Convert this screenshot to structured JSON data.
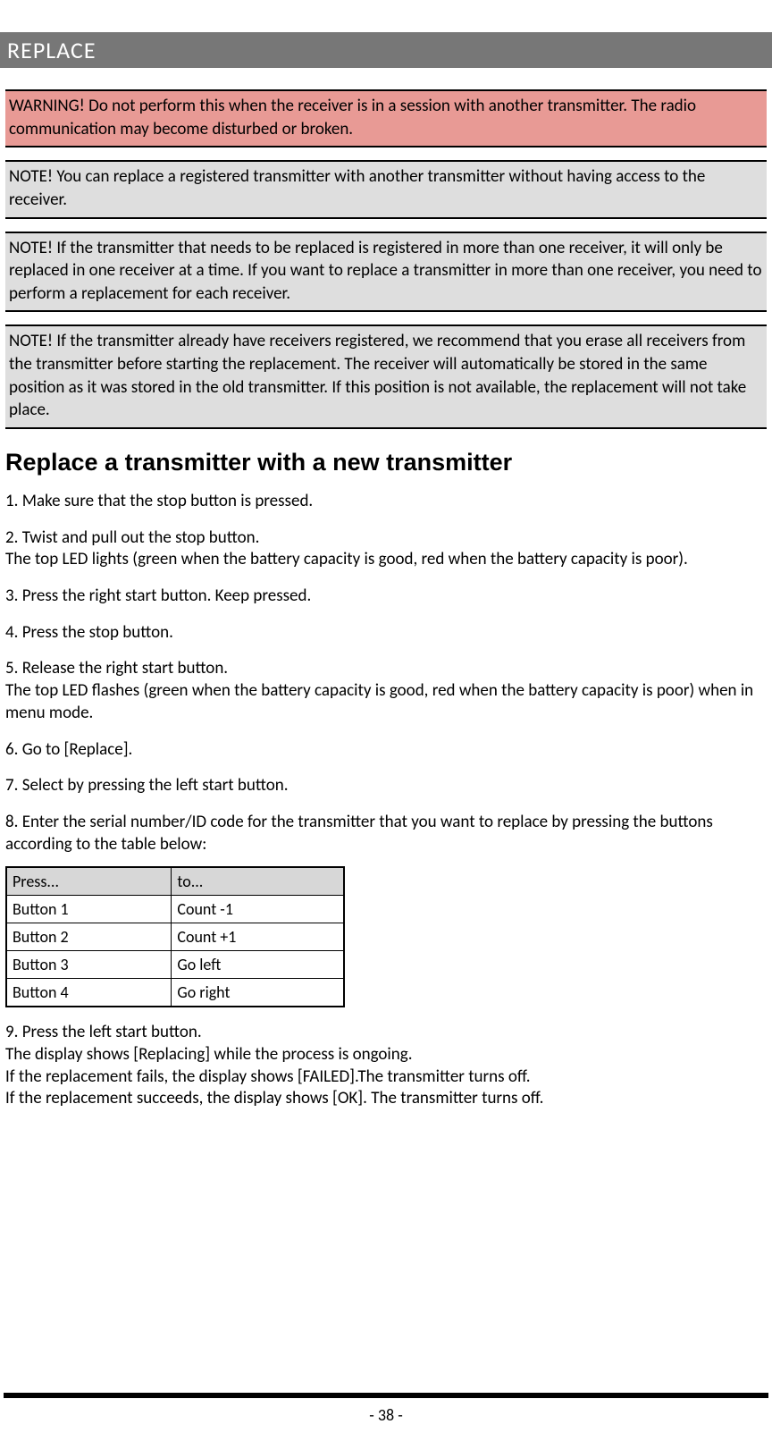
{
  "header": "REPLACE",
  "warning": "WARNING! Do not perform this when the receiver is in a session with another transmitter. The radio communication may become disturbed or broken.",
  "note1": "NOTE! You can replace a registered transmitter with another transmitter without having access to the receiver.",
  "note2": "NOTE! If the transmitter that needs to be replaced is registered in more than one receiver, it will only be replaced in one receiver at a time. If you want to replace a transmitter in more than one receiver, you need to perform a replacement for each receiver.",
  "note3": "NOTE! If the transmitter already have receivers registered, we recommend that you erase all receivers from the transmitter before starting the replacement. The receiver will automatically be stored in the same position as it was stored in the old transmitter. If this position is not available, the replacement will not take place.",
  "section_heading": "Replace a transmitter with a new transmitter",
  "steps": [
    {
      "main": "1. Make sure that the stop button is pressed.",
      "sub": ""
    },
    {
      "main": "2. Twist and pull out the stop button.",
      "sub": "The top LED lights (green when the battery capacity is good, red when the battery capacity is poor)."
    },
    {
      "main": "3. Press the right start button. Keep pressed.",
      "sub": ""
    },
    {
      "main": "4. Press the stop button.",
      "sub": ""
    },
    {
      "main": "5. Release the right start button.",
      "sub": "The top LED flashes (green when the battery capacity is good, red when the battery capacity is poor) when in menu mode."
    },
    {
      "main": "6. Go to [Replace].",
      "sub": ""
    },
    {
      "main": "7. Select by pressing the left start button.",
      "sub": ""
    },
    {
      "main": "8. Enter the serial number/ID code for the transmitter that you want to replace by pressing the buttons according to the table below:",
      "sub": ""
    }
  ],
  "table": {
    "head": {
      "c1": "Press...",
      "c2": "to..."
    },
    "rows": [
      {
        "c1": "Button 1",
        "c2": "Count -1"
      },
      {
        "c1": "Button 2",
        "c2": "Count +1"
      },
      {
        "c1": "Button 3",
        "c2": "Go left"
      },
      {
        "c1": "Button 4",
        "c2": "Go right"
      }
    ]
  },
  "step9": {
    "main": "9. Press the left start button.",
    "sub1": "The display shows [Replacing] while the process is ongoing.",
    "sub2": "If the replacement fails, the display shows [FAILED].The transmitter turns off.",
    "sub3": "If the replacement succeeds, the display shows [OK]. The transmitter turns off."
  },
  "page_number": "- 38 -"
}
